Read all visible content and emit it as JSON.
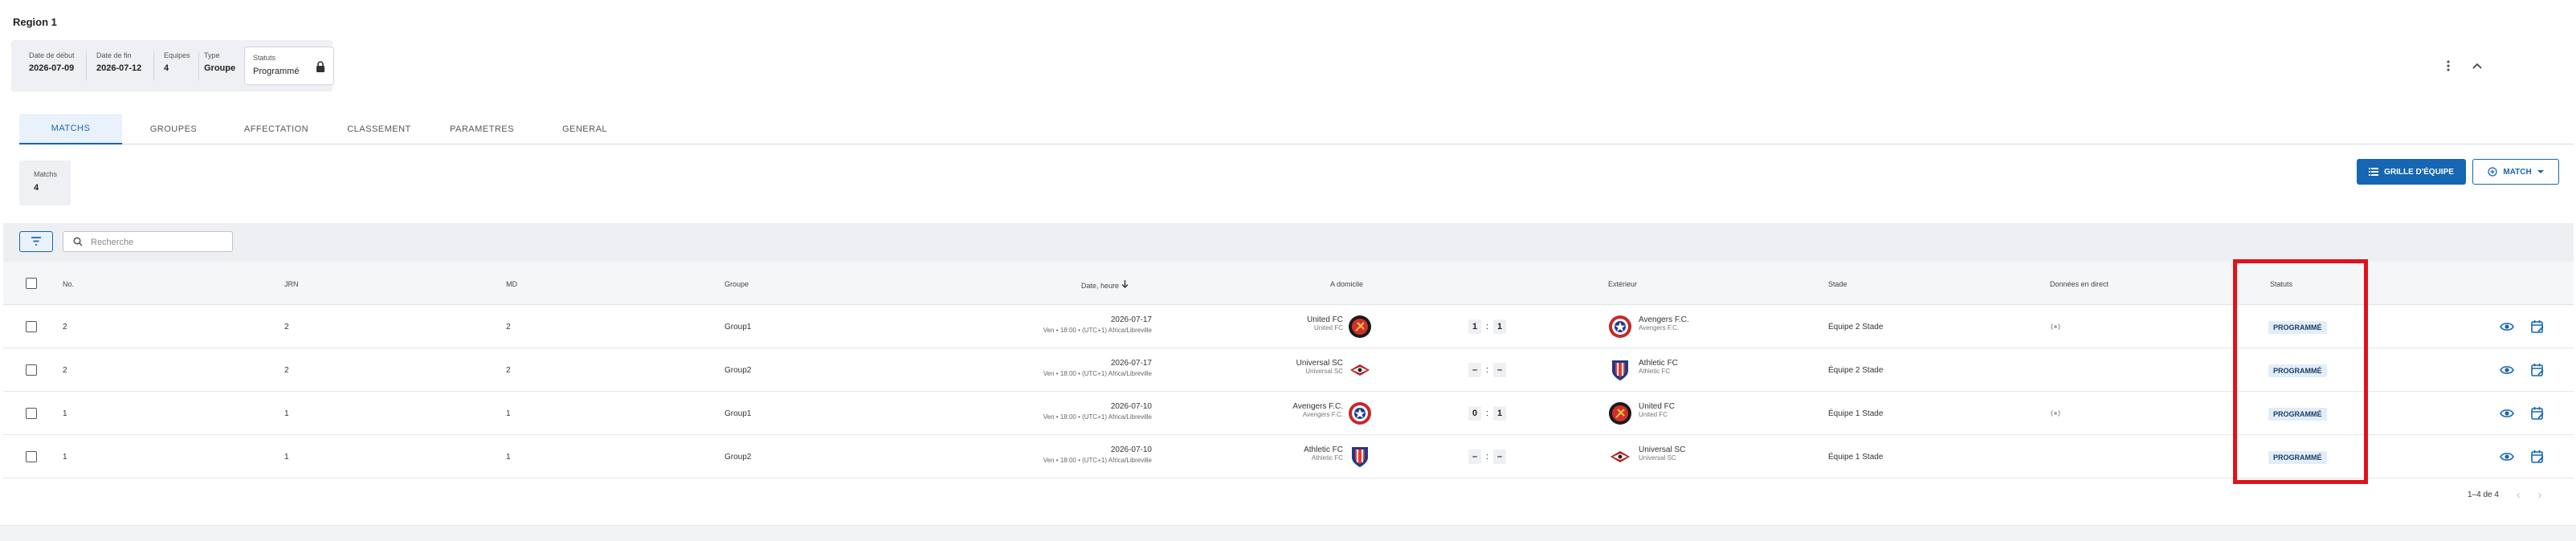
{
  "page": {
    "title": "Region 1"
  },
  "info": {
    "start_date_label": "Date de début",
    "start_date": "2026-07-09",
    "end_date_label": "Date de fin",
    "end_date": "2026-07-12",
    "teams_label": "Equipes",
    "teams": "4",
    "type_label": "Type",
    "type": "Groupe",
    "status_label": "Statuts",
    "status": "Programmé"
  },
  "tabs": [
    {
      "label": "MATCHS",
      "active": true
    },
    {
      "label": "GROUPES"
    },
    {
      "label": "AFFECTATION"
    },
    {
      "label": "CLASSEMENT"
    },
    {
      "label": "PARAMETRES"
    },
    {
      "label": "GENERAL"
    }
  ],
  "summary": {
    "matches_label": "Matchs",
    "matches": "4"
  },
  "actions": {
    "grille_label": "GRILLE D'ÉQUIPE",
    "match_label": "MATCH"
  },
  "search": {
    "placeholder": "Recherche"
  },
  "table": {
    "headers": {
      "no": "No.",
      "jrn": "JRN",
      "md": "MD",
      "group": "Groupe",
      "datetime": "Date, heure",
      "home": "A domicile",
      "away": "Extérieur",
      "stadium": "Stade",
      "live": "Données en direct",
      "status": "Statuts"
    },
    "rows": [
      {
        "no": "2",
        "jrn": "2",
        "md": "2",
        "group": "Group1",
        "date": "2026-07-17",
        "date_sub": "Ven • 18:00 • (UTC+1) Africa/Libreville",
        "home": "United FC",
        "home_sub": "United FC",
        "home_logo": "united-fc-logo",
        "score_home": "1",
        "score_away": "1",
        "away": "Avengers F.C.",
        "away_sub": "Avengers F.C.",
        "away_logo": "avengers-fc-logo",
        "stadium": "Équipe 2 Stade",
        "status": "PROGRAMMÉ"
      },
      {
        "no": "2",
        "jrn": "2",
        "md": "2",
        "group": "Group2",
        "date": "2026-07-17",
        "date_sub": "Ven • 18:00 • (UTC+1) Africa/Libreville",
        "home": "Universal SC",
        "home_sub": "Universal SC",
        "home_logo": "universal-sc-logo",
        "score_home": "–",
        "score_away": "–",
        "away": "Athletic FC",
        "away_sub": "Athletic FC",
        "away_logo": "athletic-fc-logo",
        "stadium": "Équipe 2 Stade",
        "status": "PROGRAMMÉ"
      },
      {
        "no": "1",
        "jrn": "1",
        "md": "1",
        "group": "Group1",
        "date": "2026-07-10",
        "date_sub": "Ven • 18:00 • (UTC+1) Africa/Libreville",
        "home": "Avengers F.C.",
        "home_sub": "Avengers F.C.",
        "home_logo": "avengers-fc-logo",
        "score_home": "0",
        "score_away": "1",
        "away": "United FC",
        "away_sub": "United FC",
        "away_logo": "united-fc-logo",
        "stadium": "Équipe 1 Stade",
        "status": "PROGRAMMÉ"
      },
      {
        "no": "1",
        "jrn": "1",
        "md": "1",
        "group": "Group2",
        "date": "2026-07-10",
        "date_sub": "Ven • 18:00 • (UTC+1) Africa/Libreville",
        "home": "Athletic FC",
        "home_sub": "Athletic FC",
        "home_logo": "athletic-fc-logo",
        "score_home": "–",
        "score_away": "–",
        "away": "Universal SC",
        "away_sub": "Universal SC",
        "away_logo": "universal-sc-logo",
        "stadium": "Équipe 1 Stade",
        "status": "PROGRAMMÉ"
      }
    ]
  },
  "pagination": {
    "range": "1–4 de 4"
  },
  "colors": {
    "accent": "#1566b3",
    "highlight": "#e0121a",
    "badge_bg": "#e3edf8"
  }
}
